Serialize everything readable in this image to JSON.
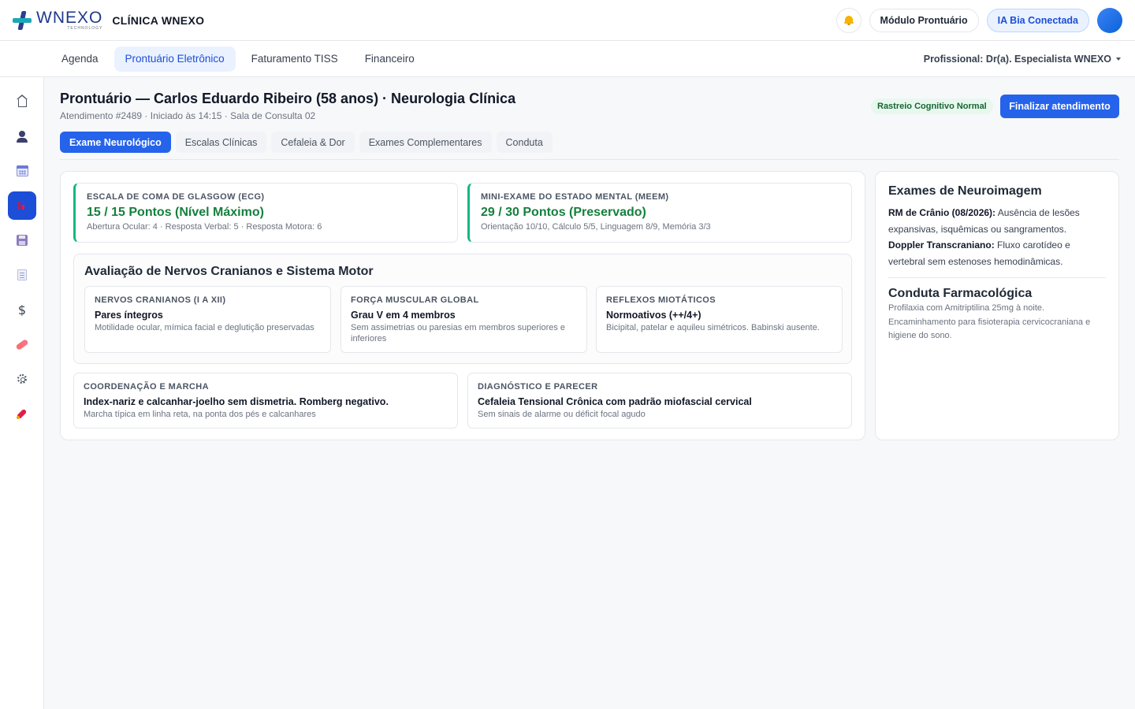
{
  "brand": {
    "logo_word": "WNEXO",
    "logo_sub": "TECHNOLOGY",
    "clinic": "CLÍNICA WNEXO"
  },
  "header": {
    "module_label": "Módulo Prontuário",
    "ia_label": "IA Bia Conectada"
  },
  "nav": {
    "tabs": [
      {
        "label": "Agenda"
      },
      {
        "label": "Prontuário Eletrônico"
      },
      {
        "label": "Faturamento TISS"
      },
      {
        "label": "Financeiro"
      }
    ],
    "professional": "Profissional: Dr(a). Especialista WNEXO"
  },
  "sidebar": {
    "dollar": "$"
  },
  "page": {
    "title": "Prontuário — Carlos Eduardo Ribeiro (58 anos) · Neurologia Clínica",
    "subtitle": "Atendimento #2489 · Iniciado às 14:15 · Sala de Consulta 02",
    "status_badge": "Rastreio Cognitivo Normal",
    "finalize_label": "Finalizar atendimento",
    "status_color": "#166534",
    "accent_color": "#2563eb"
  },
  "tabs": [
    {
      "label": "Exame Neurológico"
    },
    {
      "label": "Escalas Clínicas"
    },
    {
      "label": "Cefaleia & Dor"
    },
    {
      "label": "Exames Complementares"
    },
    {
      "label": "Conduta"
    }
  ],
  "scores": [
    {
      "label": "ESCALA DE COMA DE GLASGOW (ECG)",
      "value": "15 / 15 Pontos (Nível Máximo)",
      "detail": "Abertura Ocular: 4 · Resposta Verbal: 5 · Resposta Motora: 6"
    },
    {
      "label": "MINI-EXAME DO ESTADO MENTAL (MEEM)",
      "value": "29 / 30 Pontos (Preservado)",
      "detail": "Orientação 10/10, Cálculo 5/5, Linguagem 8/9, Memória 3/3"
    }
  ],
  "nerves": {
    "title": "Avaliação de Nervos Cranianos e Sistema Motor",
    "items": [
      {
        "label": "NERVOS CRANIANOS (I A XII)",
        "value": "Pares íntegros",
        "detail": "Motilidade ocular, mímica facial e deglutição preservadas"
      },
      {
        "label": "FORÇA MUSCULAR GLOBAL",
        "value": "Grau V em 4 membros",
        "detail": "Sem assimetrias ou paresias em membros superiores e inferiores"
      },
      {
        "label": "REFLEXOS MIOTÁTICOS",
        "value": "Normoativos (++/4+)",
        "detail": "Bicipital, patelar e aquileu simétricos. Babinski ausente."
      }
    ]
  },
  "bottom": [
    {
      "label": "COORDENAÇÃO E MARCHA",
      "value": "Index-nariz e calcanhar-joelho sem dismetria. Romberg negativo.",
      "detail": "Marcha típica em linha reta, na ponta dos pés e calcanhares"
    },
    {
      "label": "DIAGNÓSTICO E PARECER",
      "value": "Cefaleia Tensional Crônica com padrão miofascial cervical",
      "detail": "Sem sinais de alarme ou déficit focal agudo"
    }
  ],
  "neuro": {
    "title": "Exames de Neuroimagem",
    "rm_label": "RM de Crânio (08/2026):",
    "rm_text": " Ausência de lesões expansivas, isquêmicas ou sangramentos.",
    "doppler_label": "Doppler Transcraniano:",
    "doppler_text": " Fluxo carotídeo e vertebral sem estenoses hemodinâmicas."
  },
  "conduta": {
    "title": "Conduta Farmacológica",
    "line1": "Profilaxia com Amitriptilina 25mg à noite.",
    "line2": "Encaminhamento para fisioterapia cervicocraniana e higiene do sono."
  }
}
